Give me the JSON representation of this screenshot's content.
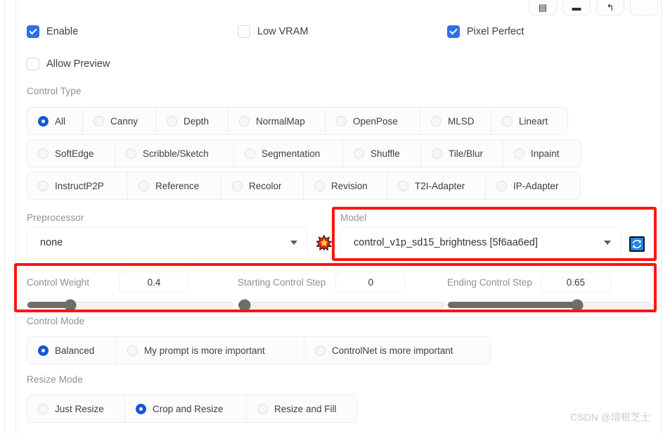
{
  "toolbar": {
    "buttons": [
      {
        "name": "image-to-canvas-icon",
        "glyph": "▤"
      },
      {
        "name": "camera-icon",
        "glyph": "▬"
      },
      {
        "name": "send-back-arrow-icon",
        "glyph": "↰"
      },
      {
        "name": "blank-icon",
        "glyph": ""
      }
    ]
  },
  "checkboxes": [
    {
      "label": "Enable",
      "checked": true
    },
    {
      "label": "Low VRAM",
      "checked": false
    },
    {
      "label": "Pixel Perfect",
      "checked": true
    },
    {
      "label": "Allow Preview",
      "checked": false
    }
  ],
  "control_type": {
    "label": "Control Type",
    "selected": "All",
    "rows": [
      [
        "All",
        "Canny",
        "Depth",
        "NormalMap",
        "OpenPose",
        "MLSD",
        "Lineart"
      ],
      [
        "SoftEdge",
        "Scribble/Sketch",
        "Segmentation",
        "Shuffle",
        "Tile/Blur",
        "Inpaint"
      ],
      [
        "InstructP2P",
        "Reference",
        "Recolor",
        "Revision",
        "T2I-Adapter",
        "IP-Adapter"
      ]
    ]
  },
  "preprocessor": {
    "label": "Preprocessor",
    "value": "none",
    "action_icon": "explosion-icon"
  },
  "model": {
    "label": "Model",
    "value": "control_v1p_sd15_brightness [5f6aa6ed]",
    "action_icon": "refresh-icon"
  },
  "sliders": [
    {
      "name": "Control Weight",
      "value": "0.4",
      "percent": 21
    },
    {
      "name": "Starting Control Step",
      "value": "0",
      "percent": 2
    },
    {
      "name": "Ending Control Step",
      "value": "0.65",
      "percent": 64
    }
  ],
  "control_mode": {
    "label": "Control Mode",
    "selected": "Balanced",
    "options": [
      "Balanced",
      "My prompt is more important",
      "ControlNet is more important"
    ]
  },
  "resize_mode": {
    "label": "Resize Mode",
    "selected": "Crop and Resize",
    "options": [
      "Just Resize",
      "Crop and Resize",
      "Resize and Fill"
    ]
  },
  "watermark": "CSDN @培根芝士",
  "colors": {
    "accent_checkbox": "#2f6fe4",
    "accent_radio": "#1757d6",
    "annotation": "#ff1414",
    "slider_fill": "#6d6d6d",
    "refresh_button": "#1d84e8"
  }
}
